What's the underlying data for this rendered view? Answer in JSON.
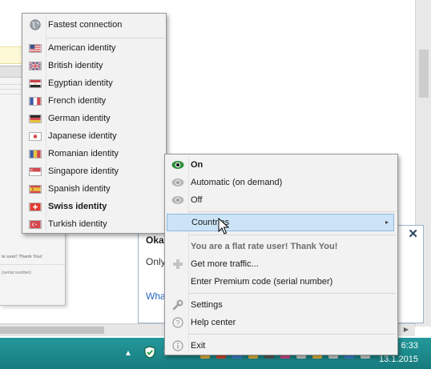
{
  "countries_menu": {
    "header": {
      "label": "Fastest connection",
      "icon": "globe-icon"
    },
    "items": [
      {
        "label": "American identity",
        "flag": "us-flag-icon",
        "bold": false
      },
      {
        "label": "British identity",
        "flag": "gb-flag-icon",
        "bold": false
      },
      {
        "label": "Egyptian identity",
        "flag": "eg-flag-icon",
        "bold": false
      },
      {
        "label": "French identity",
        "flag": "fr-flag-icon",
        "bold": false
      },
      {
        "label": "German identity",
        "flag": "de-flag-icon",
        "bold": false
      },
      {
        "label": "Japanese identity",
        "flag": "jp-flag-icon",
        "bold": false
      },
      {
        "label": "Romanian identity",
        "flag": "ro-flag-icon",
        "bold": false
      },
      {
        "label": "Singapore identity",
        "flag": "sg-flag-icon",
        "bold": false
      },
      {
        "label": "Spanish identity",
        "flag": "es-flag-icon",
        "bold": false
      },
      {
        "label": "Swiss identity",
        "flag": "ch-flag-icon",
        "bold": true
      },
      {
        "label": "Turkish identity",
        "flag": "tr-flag-icon",
        "bold": false
      }
    ]
  },
  "context_menu": {
    "mode_items": [
      {
        "label": "On",
        "icon": "eye-icon",
        "selected": true
      },
      {
        "label": "Automatic (on demand)",
        "icon": "eye-icon",
        "selected": false
      },
      {
        "label": "Off",
        "icon": "eye-icon",
        "selected": false
      }
    ],
    "countries": {
      "label": "Countries",
      "arrow": "▸"
    },
    "flat_rate": {
      "label": "You are a flat rate user! Thank You!"
    },
    "traffic": {
      "label": "Get more traffic...",
      "icon": "plus-icon"
    },
    "premium": {
      "label": "Enter Premium code (serial number)"
    },
    "settings": {
      "label": "Settings",
      "icon": "wrench-icon"
    },
    "help": {
      "label": "Help center",
      "icon": "help-icon"
    },
    "exit": {
      "label": "Exit",
      "icon": "info-icon"
    }
  },
  "notification": {
    "title": "Okay",
    "text": "Only",
    "link": "Wha",
    "close": "✕"
  },
  "background_panel": {
    "rows": [
      {
        "text": "te user! Thank You!",
        "bold": true
      },
      {
        "text": "(serial number)",
        "bold": false
      }
    ]
  },
  "taskbar": {
    "time": "6:33",
    "date": "13.1.2015",
    "tray_arrow": "▲"
  },
  "colors": {
    "menu_bg": "#f2f2f2",
    "highlight": "#cce4f7",
    "taskbar": "#1f8a8d",
    "link": "#2a66c2"
  }
}
